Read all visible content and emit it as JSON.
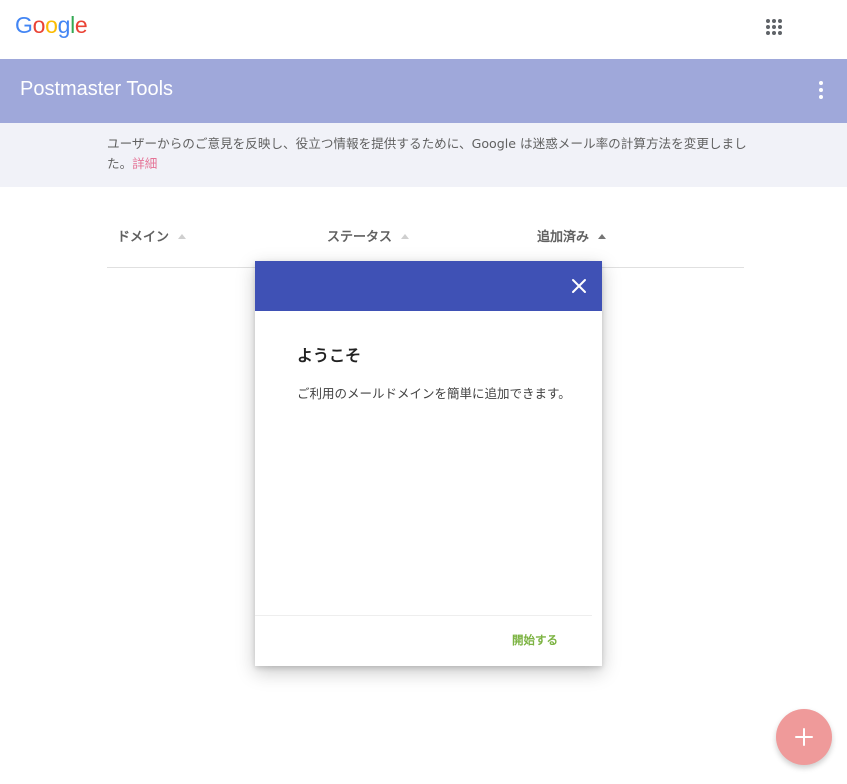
{
  "google_bar": {
    "logo": [
      {
        "char": "G",
        "color": "#4285f4"
      },
      {
        "char": "o",
        "color": "#ea4335"
      },
      {
        "char": "o",
        "color": "#fbbc05"
      },
      {
        "char": "g",
        "color": "#4285f4"
      },
      {
        "char": "l",
        "color": "#34a853"
      },
      {
        "char": "e",
        "color": "#ea4335"
      }
    ],
    "apps_icon": "apps-grid-icon"
  },
  "app_bar": {
    "title": "Postmaster Tools",
    "menu_icon": "more-vert-icon",
    "color": "#9fa8da"
  },
  "notice": {
    "text": "ユーザーからのご意見を反映し、役立つ情報を提供するために、Google は迷惑メール率の計算方法を変更しました。",
    "link": "詳細"
  },
  "table": {
    "columns": [
      {
        "label": "ドメイン",
        "sort": "none"
      },
      {
        "label": "ステータス",
        "sort": "none"
      },
      {
        "label": "追加済み",
        "sort": "ascending"
      }
    ]
  },
  "dialog": {
    "title": "ようこそ",
    "body": "ご利用のメールドメインを簡単に追加できます。",
    "close_icon": "close-icon",
    "primary_action": "開始する",
    "header_color": "#3f51b5",
    "action_color": "#7cb342"
  },
  "fab": {
    "icon": "plus-icon",
    "color": "#ef9a9a"
  }
}
